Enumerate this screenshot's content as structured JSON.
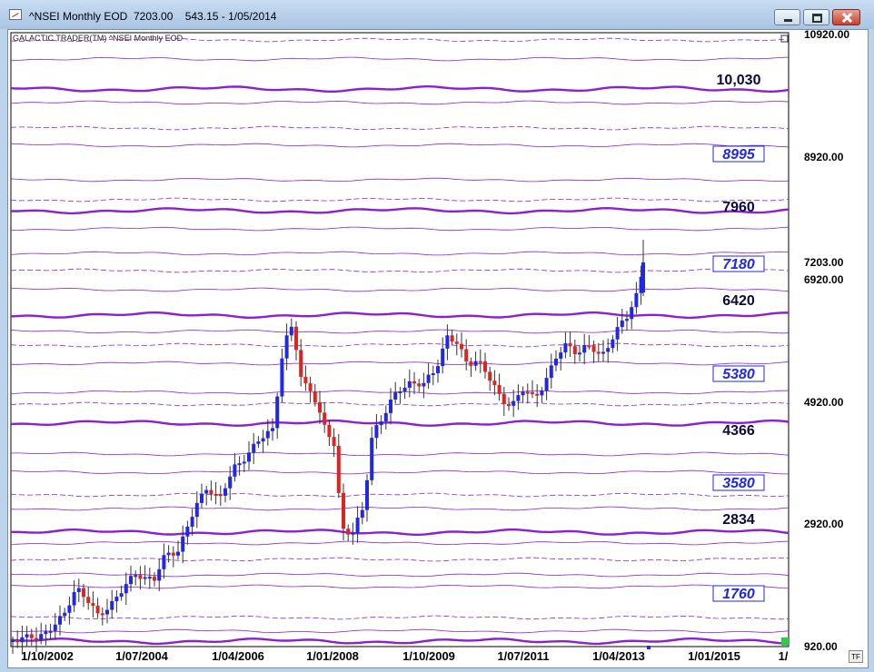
{
  "window": {
    "title": "^NSEI Monthly EOD  7203.00    543.15 - 1/05/2014",
    "buttons": {
      "minimize": "minimize",
      "maximize": "maximize",
      "close": "close"
    }
  },
  "chart_header": {
    "caption": "GALACTIC TRADER(TM)    ^NSEI Monthly EOD"
  },
  "corner_button": "TF",
  "colors": {
    "up": "#1f28e8",
    "down": "#e0231d",
    "grid": "#8a1fd6",
    "background": "#ffffff",
    "frame": "#bcd3ec"
  },
  "chart_data": {
    "type": "candlestick",
    "title": "^NSEI Monthly EOD",
    "y_ticks": [
      "10920.00",
      "8920.00",
      "7203.00",
      "6920.00",
      "4920.00",
      "2920.00",
      "920.00"
    ],
    "x_ticks": [
      "1/10/2002",
      "1/07/2004",
      "1/04/2006",
      "1/01/2008",
      "1/10/2009",
      "1/07/2011",
      "1/04/2013",
      "1/01/2015",
      "1/"
    ],
    "levels": [
      {
        "label": "10,030",
        "boxed": false
      },
      {
        "label": "8995",
        "boxed": true
      },
      {
        "label": "7960",
        "boxed": false
      },
      {
        "label": "7180",
        "boxed": true
      },
      {
        "label": "6420",
        "boxed": false
      },
      {
        "label": "5380",
        "boxed": true
      },
      {
        "label": "4366",
        "boxed": false
      },
      {
        "label": "3580",
        "boxed": true
      },
      {
        "label": "2834",
        "boxed": false
      },
      {
        "label": "1760",
        "boxed": true
      }
    ],
    "last_close": 7203,
    "range_start": "1/10/2002",
    "range_end": "1/05/2014"
  }
}
